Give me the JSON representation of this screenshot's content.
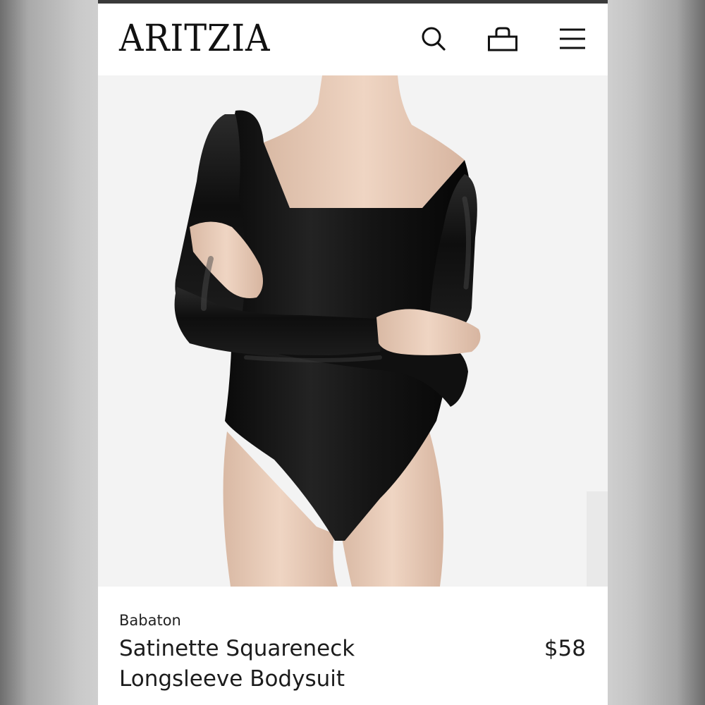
{
  "header": {
    "logo": "ARITZIA",
    "icons": [
      "search-icon",
      "shopping-bag-icon",
      "menu-icon"
    ]
  },
  "product": {
    "brand": "Babaton",
    "title_line1": "Satinette Squareneck",
    "title_line2": "Longsleeve Bodysuit",
    "price": "$58",
    "color": "#111111"
  },
  "colors": {
    "text": "#111111",
    "image_background": "#f3f3f3",
    "page_background": "#ffffff"
  }
}
